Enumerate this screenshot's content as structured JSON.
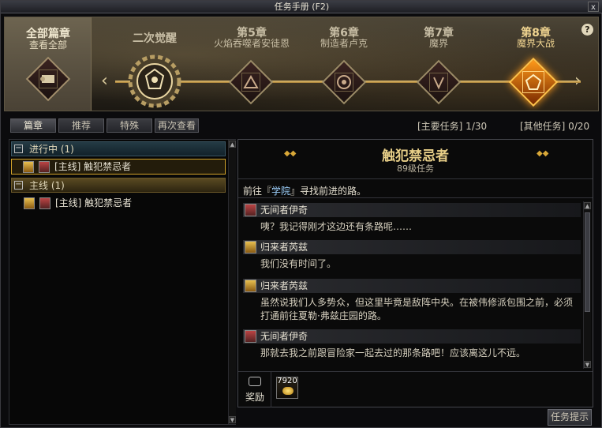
{
  "window": {
    "title": "任务手册 (F2)",
    "close_label": "x"
  },
  "chapters": {
    "all": {
      "title": "全部篇章",
      "subtitle": "查看全部"
    },
    "items": [
      {
        "title": "二次觉醒",
        "subtitle": "",
        "state": "completed"
      },
      {
        "title": "第5章",
        "subtitle": "火焰吞噬者安徒恩",
        "state": "locked"
      },
      {
        "title": "第6章",
        "subtitle": "制造者卢克",
        "state": "locked"
      },
      {
        "title": "第7章",
        "subtitle": "魔界",
        "state": "locked"
      },
      {
        "title": "第8章",
        "subtitle": "魔界大战",
        "state": "active"
      }
    ],
    "help_label": "?"
  },
  "tabs": [
    {
      "label": "篇章"
    },
    {
      "label": "推荐"
    },
    {
      "label": "特殊"
    },
    {
      "label": "再次查看"
    }
  ],
  "counts": {
    "main": "[主要任务] 1/30",
    "other": "[其他任务] 0/20"
  },
  "list": {
    "group_in_progress": "进行中 (1)",
    "group_main": "主线 (1)",
    "quest_in_progress": "[主线] 触犯禁忌者",
    "quest_main": "[主线] 触犯禁忌者"
  },
  "detail": {
    "title": "触犯禁忌者",
    "level": "89级任务",
    "goal_prefix": "前往『",
    "goal_highlight": "学院",
    "goal_suffix": "』寻找前进的路。",
    "dialogs": [
      {
        "speaker": "无间者伊奇",
        "text": "咦？我记得刚才这边还有条路呢……"
      },
      {
        "speaker": "归来者芮兹",
        "text": "我们没有时间了。"
      },
      {
        "speaker": "归来者芮兹",
        "text": "虽然说我们人多势众，但这里毕竟是敌阵中央。在被伟修派包围之前，必须打通前往夏勒·弗兹庄园的路。"
      },
      {
        "speaker": "无间者伊奇",
        "text": "那就去我之前跟冒险家一起去过的那条路吧！应该离这儿不远。"
      }
    ],
    "reward_label": "奖励",
    "reward_qty": "7920"
  },
  "hint_button": "任务提示"
}
